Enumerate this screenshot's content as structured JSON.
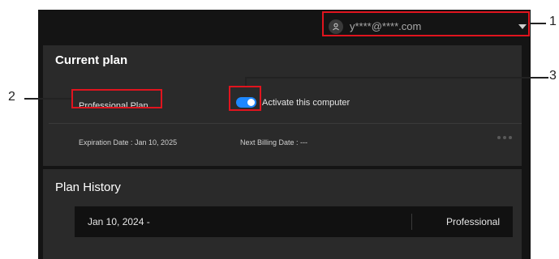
{
  "account": {
    "email": "y****@****.com"
  },
  "current_plan": {
    "title": "Current plan",
    "plan_name": "Professional Plan",
    "activate_label": "Activate this computer",
    "activate_on": true,
    "expiration": "Expiration Date : Jan 10, 2025",
    "next_billing": "Next Billing Date : ---"
  },
  "history": {
    "title": "Plan History",
    "rows": [
      {
        "date": "Jan 10, 2024 -",
        "plan": "Professional"
      }
    ]
  },
  "callouts": [
    "1",
    "2",
    "3"
  ],
  "colors": {
    "toggle_on": "#1e88ff",
    "highlight": "#e0141e"
  }
}
